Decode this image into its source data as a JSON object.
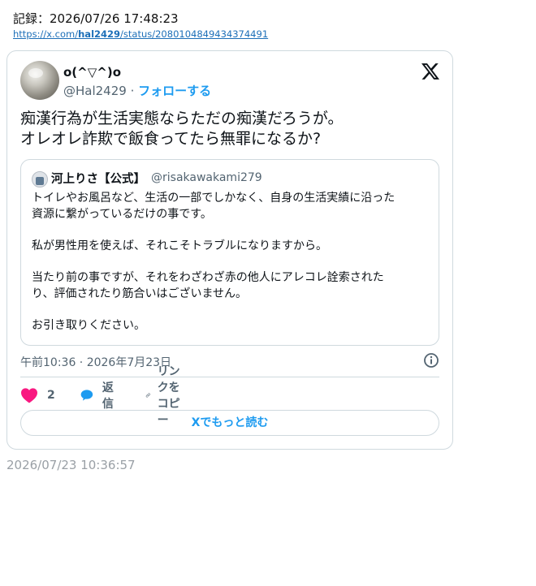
{
  "record": {
    "label": "記録：2026/07/26 17:48:23",
    "link_prefix": "https://x.com/",
    "link_user": "hal2429",
    "link_suffix": "/status/2080104849434374491"
  },
  "tweet": {
    "display_name": "o(^▽^)o",
    "handle": "@Hal2429",
    "separator": " · ",
    "follow_label": "フォローする",
    "text_lines": [
      "痴漢行為が生活実態ならただの痴漢だろうが。",
      "オレオレ詐欺で飯食ってたら無罪になるか?"
    ],
    "timestamp": "午前10:36 · 2026年7月23日",
    "like_count": "2",
    "reply_label": "返信",
    "copy_link_label": "リンクをコピー",
    "read_more_label": "Xでもっと読む",
    "colors": {
      "like": "#f91880",
      "reply": "#1d9bf0",
      "link": "#1d9bf0"
    }
  },
  "quoted": {
    "display_name": "河上りさ【公式】",
    "handle": "@risakawakami279",
    "lines": [
      "トイレやお風呂など、生活の一部でしかなく、自身の生活実績に沿った",
      "資源に繋がっているだけの事です。",
      "",
      "私が男性用を使えば、それこそトラブルになりますから。",
      "",
      "当たり前の事ですが、それをわざわざ赤の他人にアレコレ詮索された",
      "り、評価されたり筋合いはございません。",
      "",
      "お引き取りください。"
    ]
  },
  "footer": {
    "time": "2026/07/23 10:36:57"
  }
}
